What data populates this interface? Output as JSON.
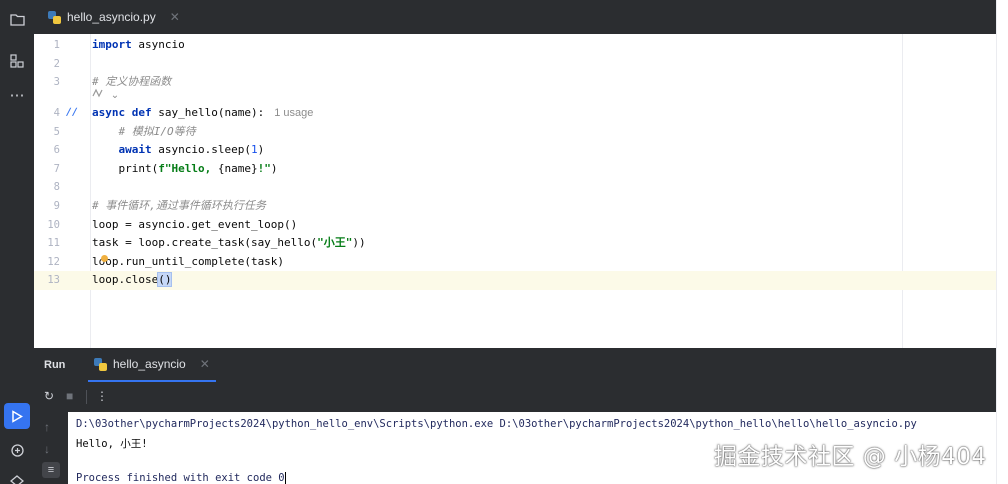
{
  "tab": {
    "filename": "hello_asyncio.py"
  },
  "editor": {
    "lines": [
      {
        "n": "1",
        "parts": [
          [
            "kw",
            "import"
          ],
          [
            "plain",
            " asyncio"
          ]
        ]
      },
      {
        "n": "2",
        "parts": []
      },
      {
        "n": "3",
        "parts": [
          [
            "cm",
            "# 定义协程函数"
          ]
        ]
      },
      {
        "n": "4",
        "parts": [
          [
            "kw",
            "async"
          ],
          [
            "plain",
            " "
          ],
          [
            "kw",
            "def"
          ],
          [
            "plain",
            " say_hello(name):"
          ]
        ],
        "usage": "1 usage"
      },
      {
        "n": "5",
        "parts": [
          [
            "plain",
            "    "
          ],
          [
            "cm",
            "# 模拟I/O等待"
          ]
        ]
      },
      {
        "n": "6",
        "parts": [
          [
            "plain",
            "    "
          ],
          [
            "kw",
            "await"
          ],
          [
            "plain",
            " asyncio.sleep("
          ],
          [
            "num",
            "1"
          ],
          [
            "plain",
            ")"
          ]
        ]
      },
      {
        "n": "7",
        "parts": [
          [
            "plain",
            "    print("
          ],
          [
            "str",
            "f\"Hello, "
          ],
          [
            "plain",
            "{name}"
          ],
          [
            "str",
            "!\""
          ],
          [
            "plain",
            ")"
          ]
        ]
      },
      {
        "n": "8",
        "parts": []
      },
      {
        "n": "9",
        "parts": [
          [
            "cm",
            "# 事件循环,通过事件循环执行任务"
          ]
        ]
      },
      {
        "n": "10",
        "parts": [
          [
            "plain",
            "loop = asyncio.get_event_loop()"
          ]
        ]
      },
      {
        "n": "11",
        "parts": [
          [
            "plain",
            "task = loop.create_task(say_hello("
          ],
          [
            "str",
            "\"小王\""
          ],
          [
            "plain",
            "))"
          ]
        ]
      },
      {
        "n": "12",
        "parts": [
          [
            "plain",
            "loop.run_until_complete(task)"
          ]
        ]
      },
      {
        "n": "13",
        "parts": [
          [
            "plain",
            "loop.close"
          ],
          [
            "hl",
            "()"
          ]
        ]
      }
    ]
  },
  "run": {
    "title": "Run",
    "tab_label": "hello_asyncio",
    "output": [
      "D:\\03other\\pycharmProjects2024\\python_hello_env\\Scripts\\python.exe D:\\03other\\pycharmProjects2024\\python_hello\\hello\\hello_asyncio.py",
      "Hello, 小王!",
      "",
      "Process finished with exit code 0"
    ]
  },
  "watermark": "掘金技术社区 @ 小杨404",
  "icons": {
    "project": "folder-icon",
    "structure": "structure-icon",
    "more": "more-icon",
    "run": "run-icon",
    "python_console": "python-console-icon",
    "services": "services-icon",
    "rerun": "rerun-icon",
    "stop": "stop-icon",
    "options": "options-icon",
    "up": "arrow-up-icon",
    "down": "arrow-down-icon",
    "softwrap": "soft-wrap-icon",
    "override": "override-icon",
    "bulb": "bulb-icon"
  }
}
